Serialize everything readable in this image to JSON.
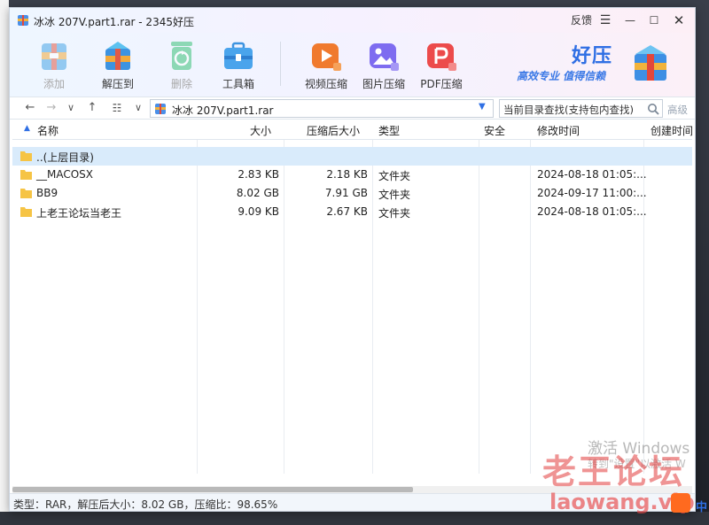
{
  "window": {
    "title": "冰冰 207V.part1.rar - 2345好压",
    "controls": {
      "feedback": "反馈",
      "menu": "☰",
      "minimize": "—",
      "maximize": "☐",
      "close": "✕"
    }
  },
  "toolbar": {
    "add": "添加",
    "extract": "解压到",
    "delete": "删除",
    "toolbox": "工具箱",
    "video": "视频压缩",
    "image": "图片压缩",
    "pdf": "PDF压缩"
  },
  "brand": {
    "name": "好压",
    "slogan": "高效专业  值得信赖"
  },
  "address": {
    "path": "冰冰 207V.part1.rar",
    "search_placeholder": "当前目录查找(支持包内查找)",
    "advanced": "高级"
  },
  "columns": [
    "名称",
    "大小",
    "压缩后大小",
    "类型",
    "安全",
    "修改时间",
    "创建时间"
  ],
  "rows": [
    {
      "name": "..(上层目录)",
      "size": "",
      "packed": "",
      "type": "",
      "security": "",
      "modified": "",
      "created": ""
    },
    {
      "name": "__MACOSX",
      "size": "2.83 KB",
      "packed": "2.18 KB",
      "type": "文件夹",
      "security": "",
      "modified": "2024-08-18 01:05:...",
      "created": ""
    },
    {
      "name": "BB9",
      "size": "8.02 GB",
      "packed": "7.91 GB",
      "type": "文件夹",
      "security": "",
      "modified": "2024-09-17 11:00:...",
      "created": ""
    },
    {
      "name": "上老王论坛当老王",
      "size": "9.09 KB",
      "packed": "2.67 KB",
      "type": "文件夹",
      "security": "",
      "modified": "2024-08-18 01:05:...",
      "created": ""
    }
  ],
  "status": "类型：RAR，解压后大小：8.02 GB，压缩比：98.65%",
  "overlay": {
    "activate_title": "激活 Windows",
    "activate_sub": "转到\"设置\"以激活 W",
    "watermark": "老王论坛",
    "watermark_url": "laowang.vip",
    "ime": "中"
  },
  "colors": {
    "accent": "#2f6fe4",
    "selection": "#d9ebfb",
    "folder": "#f6c445"
  }
}
